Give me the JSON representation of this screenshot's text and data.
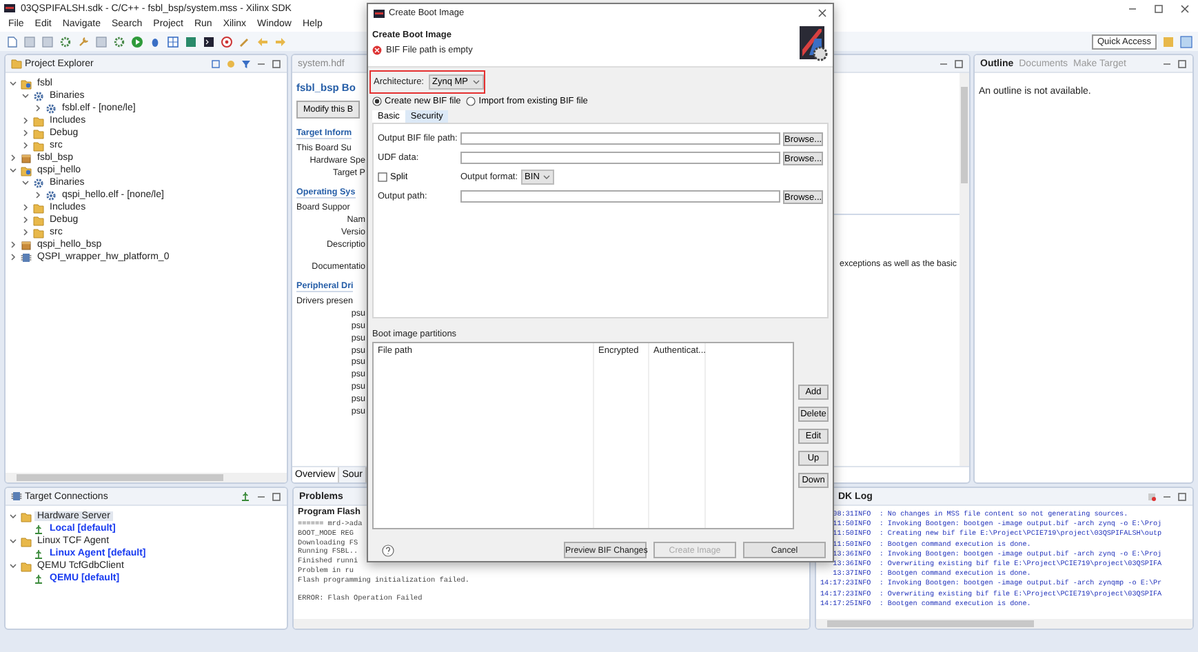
{
  "window": {
    "title": "03QSPIFALSH.sdk - C/C++ - fsbl_bsp/system.mss - Xilinx SDK"
  },
  "menu": [
    "File",
    "Edit",
    "Navigate",
    "Search",
    "Project",
    "Run",
    "Xilinx",
    "Window",
    "Help"
  ],
  "toolbar": {
    "quick_access": "Quick Access"
  },
  "project_explorer": {
    "title": "Project Explorer",
    "tree": [
      {
        "label": "fsbl",
        "kind": "project",
        "expanded": true,
        "selected": false,
        "children": [
          {
            "label": "Binaries",
            "kind": "binaries",
            "expanded": true,
            "selected": false,
            "children": [
              {
                "label": "fsbl.elf - [none/le]",
                "kind": "elf",
                "expanded": false,
                "selected": false
              }
            ]
          },
          {
            "label": "Includes",
            "kind": "includes",
            "expanded": false,
            "selected": false
          },
          {
            "label": "Debug",
            "kind": "folder",
            "expanded": false,
            "selected": false
          },
          {
            "label": "src",
            "kind": "folder",
            "expanded": false,
            "selected": false
          }
        ]
      },
      {
        "label": "fsbl_bsp",
        "kind": "bsp",
        "expanded": false,
        "selected": false
      },
      {
        "label": "qspi_hello",
        "kind": "project",
        "expanded": true,
        "selected": false,
        "children": [
          {
            "label": "Binaries",
            "kind": "binaries",
            "expanded": true,
            "selected": false,
            "children": [
              {
                "label": "qspi_hello.elf - [none/le]",
                "kind": "elf",
                "expanded": false,
                "selected": false
              }
            ]
          },
          {
            "label": "Includes",
            "kind": "includes",
            "expanded": false,
            "selected": false
          },
          {
            "label": "Debug",
            "kind": "folder",
            "expanded": false,
            "selected": false
          },
          {
            "label": "src",
            "kind": "folder",
            "expanded": false,
            "selected": false
          }
        ]
      },
      {
        "label": "qspi_hello_bsp",
        "kind": "bsp",
        "expanded": false,
        "selected": false
      },
      {
        "label": "QSPI_wrapper_hw_platform_0",
        "kind": "platform",
        "expanded": false,
        "selected": false
      }
    ]
  },
  "editor": {
    "tab": "system.hdf",
    "title": "fsbl_bsp Bo",
    "button": "Modify this B",
    "lines": [
      {
        "kind": "section",
        "text": "Target Inform"
      },
      {
        "kind": "text",
        "text": "This Board Su"
      },
      {
        "kind": "label",
        "text": "Hardware Spe"
      },
      {
        "kind": "label",
        "text": "Target P"
      },
      {
        "kind": "section",
        "text": "Operating Sys"
      },
      {
        "kind": "text",
        "text": "Board Suppor"
      },
      {
        "kind": "label",
        "text": "Nam"
      },
      {
        "kind": "label",
        "text": "Versio"
      },
      {
        "kind": "label",
        "text": "Descriptio"
      },
      {
        "kind": "gap_label",
        "text": "Documentatio"
      },
      {
        "kind": "section",
        "text": "Peripheral Dri"
      },
      {
        "kind": "text",
        "text": "Drivers presen"
      },
      {
        "kind": "item",
        "text": "psu"
      },
      {
        "kind": "item",
        "text": "psu"
      },
      {
        "kind": "item",
        "text": "psu"
      },
      {
        "kind": "item",
        "text": "psu"
      },
      {
        "kind": "item",
        "text": "psu"
      },
      {
        "kind": "item",
        "text": "psu"
      },
      {
        "kind": "item",
        "text": "psu"
      },
      {
        "kind": "item",
        "text": "psu"
      },
      {
        "kind": "item",
        "text": "psu"
      }
    ],
    "side_text": "exceptions as well as the basic",
    "bottom_tabs": [
      {
        "label": "Overview",
        "selected": true
      },
      {
        "label": "Sour",
        "selected": false
      }
    ]
  },
  "outline": {
    "tabs": [
      {
        "label": "Outline",
        "selected": true
      },
      {
        "label": "Documents",
        "selected": false
      },
      {
        "label": "Make Target",
        "selected": false
      }
    ],
    "message": "An outline is not available."
  },
  "target_connections": {
    "title": "Target Connections",
    "tree": [
      {
        "label": "Hardware Server",
        "kind": "folder",
        "expanded": true,
        "selected": true,
        "children": [
          {
            "label": "Local [default]",
            "kind": "connection",
            "selected": false
          }
        ]
      },
      {
        "label": "Linux TCF Agent",
        "kind": "folder",
        "expanded": true,
        "selected": false,
        "children": [
          {
            "label": "Linux Agent [default]",
            "kind": "connection",
            "selected": false
          }
        ]
      },
      {
        "label": "QEMU TcfGdbClient",
        "kind": "folder",
        "expanded": true,
        "selected": false,
        "children": [
          {
            "label": "QEMU [default]",
            "kind": "connection",
            "selected": false
          }
        ]
      }
    ]
  },
  "problems": {
    "tab": "Problems",
    "title": "Program Flash",
    "lines": [
      {
        "kind": "output",
        "text": "====== mrd->ada"
      },
      {
        "kind": "output",
        "text": "BOOT_MODE REG"
      },
      {
        "kind": "output",
        "text": "Downloading FS"
      },
      {
        "kind": "output",
        "text": "Running FSBL.."
      },
      {
        "kind": "output",
        "text": "Finished runni"
      },
      {
        "kind": "output",
        "text": "Problem in ru"
      },
      {
        "kind": "output",
        "text": "Flash programming initialization failed."
      },
      {
        "kind": "error",
        "text": "ERROR: Flash Operation Failed"
      }
    ]
  },
  "sdk_log": {
    "tab": "DK Log",
    "lines": [
      {
        "time": "08:31",
        "level": "INFO",
        "message": ": No changes in MSS file content so not generating sources."
      },
      {
        "time": "11:50",
        "level": "INFO",
        "message": ": Invoking Bootgen: bootgen -image output.bif -arch zynq -o E:\\Proj"
      },
      {
        "time": "11:50",
        "level": "INFO",
        "message": ": Creating new bif file E:\\Project\\PCIE719\\project\\03QSPIFALSH\\outp"
      },
      {
        "time": "11:50",
        "level": "INFO",
        "message": ": Bootgen command execution is done."
      },
      {
        "time": "13:36",
        "level": "INFO",
        "message": ": Invoking Bootgen: bootgen -image output.bif -arch zynq -o E:\\Proj"
      },
      {
        "time": "13:36",
        "level": "INFO",
        "message": ": Overwriting existing bif file E:\\Project\\PCIE719\\project\\03QSPIFA"
      },
      {
        "time": "13:37",
        "level": "INFO",
        "message": ": Bootgen command execution is done."
      },
      {
        "time": "14:17:23",
        "level": "INFO",
        "message": ": Invoking Bootgen: bootgen -image output.bif -arch zynqmp -o E:\\Pr"
      },
      {
        "time": "14:17:23",
        "level": "INFO",
        "message": ": Overwriting existing bif file E:\\Project\\PCIE719\\project\\03QSPIFA"
      },
      {
        "time": "14:17:25",
        "level": "INFO",
        "message": ": Bootgen command execution is done."
      }
    ]
  },
  "dialog": {
    "title": "Create Boot Image",
    "heading": "Create Boot Image",
    "message": "BIF File path is empty",
    "architecture": {
      "label": "Architecture:",
      "value": "Zynq MP"
    },
    "radios": [
      {
        "label": "Create new BIF file",
        "selected": true
      },
      {
        "label": "Import from existing BIF file",
        "selected": false
      }
    ],
    "tabs": [
      {
        "label": "Basic",
        "selected": true
      },
      {
        "label": "Security",
        "selected": false
      }
    ],
    "fields": [
      {
        "label": "Output BIF file path:",
        "button": "Browse..."
      },
      {
        "label": "UDF data:",
        "button": "Browse..."
      }
    ],
    "split": {
      "label": "Split",
      "checked": false
    },
    "output_format": {
      "label": "Output format:",
      "value": "BIN"
    },
    "output_path": {
      "label": "Output path:",
      "button": "Browse..."
    },
    "partitions": {
      "title": "Boot image partitions",
      "columns": [
        "File path",
        "Encrypted",
        "Authenticat..."
      ],
      "buttons": [
        "Add",
        "Delete",
        "Edit",
        "Up",
        "Down"
      ]
    },
    "footer_buttons": [
      {
        "label": "Preview BIF Changes",
        "disabled": false
      },
      {
        "label": "Create Image",
        "disabled": true
      },
      {
        "label": "Cancel",
        "disabled": false
      }
    ]
  }
}
